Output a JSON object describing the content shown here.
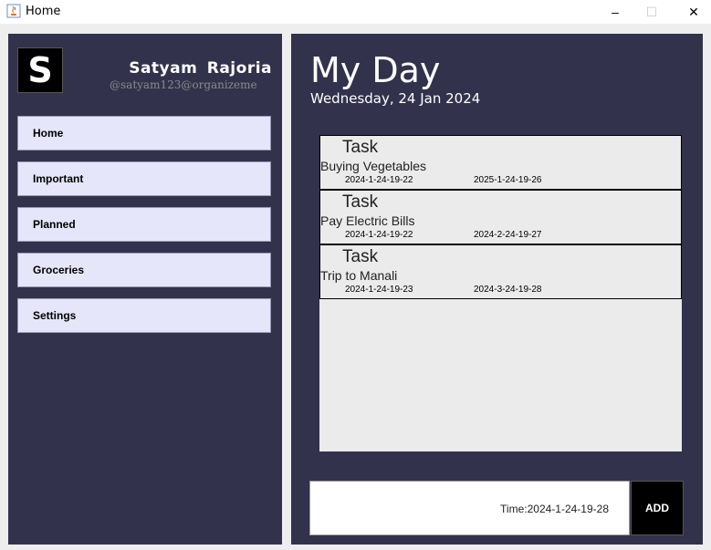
{
  "window": {
    "title": "Home",
    "icon": "java-cup-icon",
    "controls": {
      "minimize": "–",
      "maximize": "☐",
      "close": "✕"
    }
  },
  "profile": {
    "logo_letter": "S",
    "name": "Satyam  Rajoria",
    "handle": "@satyam123@organizeme"
  },
  "sidebar": {
    "items": [
      {
        "label": "Home"
      },
      {
        "label": "Important"
      },
      {
        "label": "Planned"
      },
      {
        "label": "Groceries"
      },
      {
        "label": "Settings"
      }
    ]
  },
  "main": {
    "title": "My Day",
    "date": "Wednesday, 24 Jan 2024",
    "tasks": [
      {
        "label": "Task",
        "name": "Buying Vegetables",
        "created": "2024-1-24-19-22",
        "due": "2025-1-24-19-26"
      },
      {
        "label": "Task",
        "name": "Pay Electric Bills",
        "created": "2024-1-24-19-22",
        "due": "2024-2-24-19-27"
      },
      {
        "label": "Task",
        "name": "Trip to Manali",
        "created": "2024-1-24-19-23",
        "due": "2024-3-24-19-28"
      }
    ],
    "time_text": "Time:2024-1-24-19-28",
    "add_label": "ADD"
  },
  "colors": {
    "panel_bg": "#33324c",
    "nav_item_bg": "#e6e6fa",
    "task_list_bg": "#ebebeb"
  }
}
